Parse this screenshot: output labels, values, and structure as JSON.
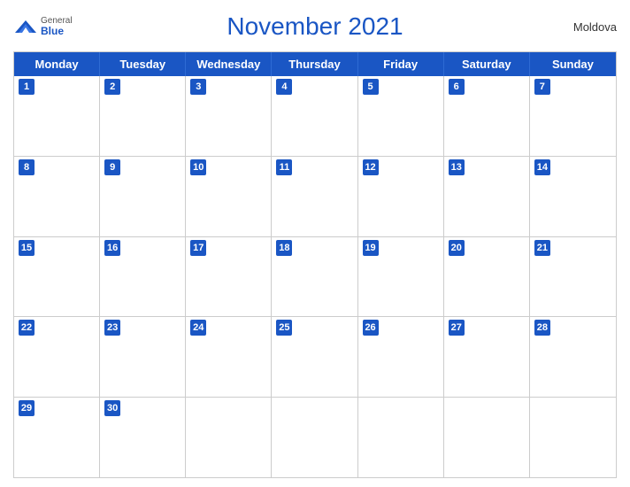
{
  "header": {
    "title": "November 2021",
    "country": "Moldova",
    "logo_general": "General",
    "logo_blue": "Blue"
  },
  "days_of_week": [
    "Monday",
    "Tuesday",
    "Wednesday",
    "Thursday",
    "Friday",
    "Saturday",
    "Sunday"
  ],
  "weeks": [
    [
      {
        "day": 1,
        "empty": false
      },
      {
        "day": 2,
        "empty": false
      },
      {
        "day": 3,
        "empty": false
      },
      {
        "day": 4,
        "empty": false
      },
      {
        "day": 5,
        "empty": false
      },
      {
        "day": 6,
        "empty": false
      },
      {
        "day": 7,
        "empty": false
      }
    ],
    [
      {
        "day": 8,
        "empty": false
      },
      {
        "day": 9,
        "empty": false
      },
      {
        "day": 10,
        "empty": false
      },
      {
        "day": 11,
        "empty": false
      },
      {
        "day": 12,
        "empty": false
      },
      {
        "day": 13,
        "empty": false
      },
      {
        "day": 14,
        "empty": false
      }
    ],
    [
      {
        "day": 15,
        "empty": false
      },
      {
        "day": 16,
        "empty": false
      },
      {
        "day": 17,
        "empty": false
      },
      {
        "day": 18,
        "empty": false
      },
      {
        "day": 19,
        "empty": false
      },
      {
        "day": 20,
        "empty": false
      },
      {
        "day": 21,
        "empty": false
      }
    ],
    [
      {
        "day": 22,
        "empty": false
      },
      {
        "day": 23,
        "empty": false
      },
      {
        "day": 24,
        "empty": false
      },
      {
        "day": 25,
        "empty": false
      },
      {
        "day": 26,
        "empty": false
      },
      {
        "day": 27,
        "empty": false
      },
      {
        "day": 28,
        "empty": false
      }
    ],
    [
      {
        "day": 29,
        "empty": false
      },
      {
        "day": 30,
        "empty": false
      },
      {
        "day": null,
        "empty": true
      },
      {
        "day": null,
        "empty": true
      },
      {
        "day": null,
        "empty": true
      },
      {
        "day": null,
        "empty": true
      },
      {
        "day": null,
        "empty": true
      }
    ]
  ],
  "colors": {
    "header_bg": "#1a56c4",
    "accent": "#1a56c4"
  }
}
